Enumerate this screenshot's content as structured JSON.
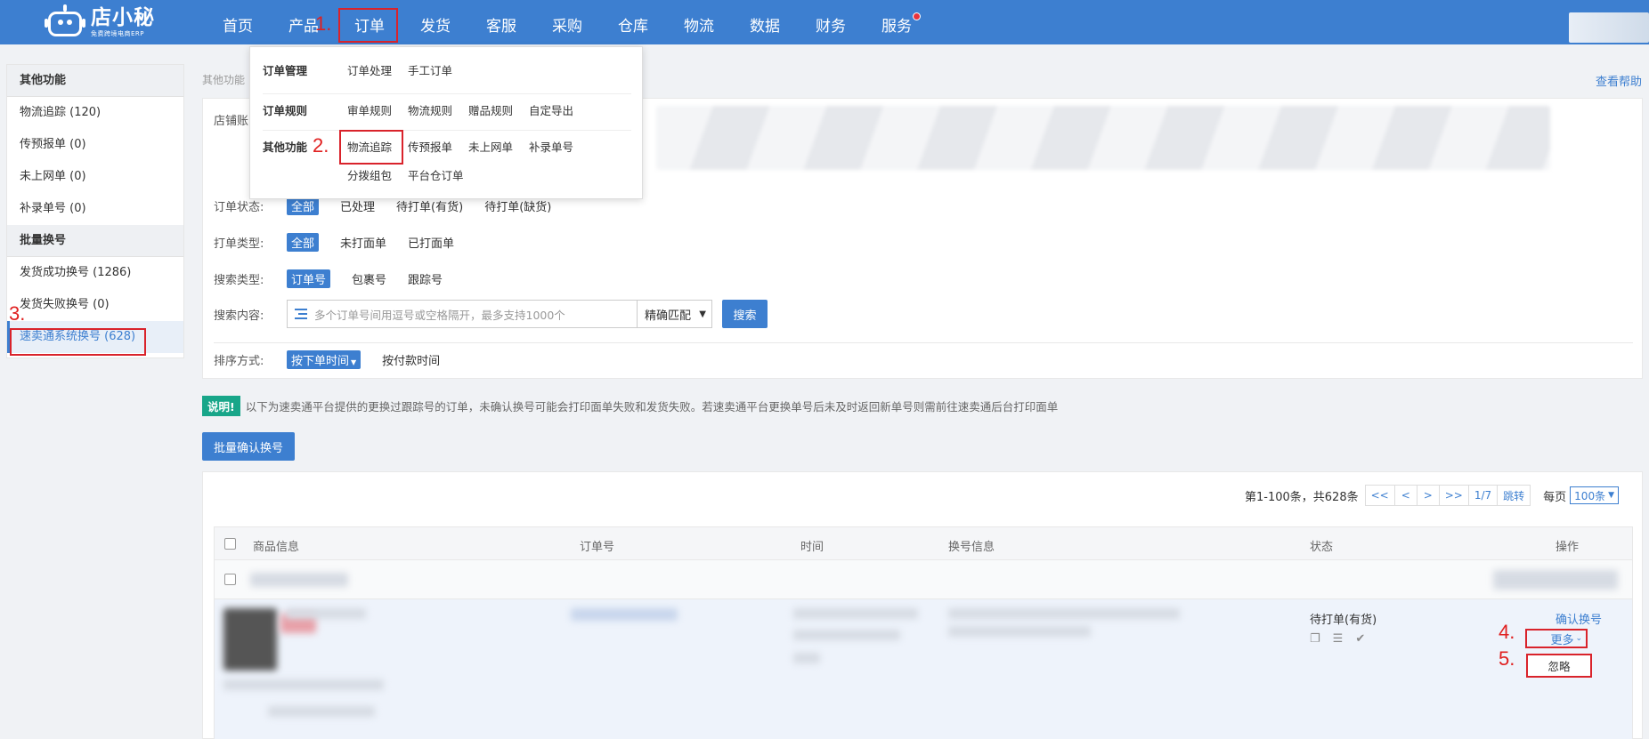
{
  "brand": {
    "name": "店小秘",
    "subtitle": "免费跨境电商ERP"
  },
  "nav": [
    {
      "label": "首页"
    },
    {
      "label": "产品"
    },
    {
      "label": "订单"
    },
    {
      "label": "发货"
    },
    {
      "label": "客服"
    },
    {
      "label": "采购"
    },
    {
      "label": "仓库"
    },
    {
      "label": "物流"
    },
    {
      "label": "数据"
    },
    {
      "label": "财务"
    },
    {
      "label": "服务"
    }
  ],
  "annotations": [
    "1.",
    "2.",
    "3.",
    "4.",
    "5."
  ],
  "dropdown": {
    "groups": [
      {
        "title": "订单管理",
        "links": [
          "订单处理",
          "手工订单"
        ]
      },
      {
        "title": "订单规则",
        "links": [
          "审单规则",
          "物流规则",
          "赠品规则",
          "自定导出"
        ]
      },
      {
        "title": "其他功能",
        "links": [
          "物流追踪",
          "传预报单",
          "未上网单",
          "补录单号"
        ],
        "extra": [
          "分拨组包",
          "平台仓订单"
        ]
      }
    ]
  },
  "sidebar": {
    "group1": "其他功能",
    "items1": [
      "物流追踪 (120)",
      "传预报单 (0)",
      "未上网单 (0)",
      "补录单号 (0)"
    ],
    "group2": "批量换号",
    "items2": [
      "发货成功换号 (1286)",
      "发货失败换号 (0)",
      "速卖通系统换号 (628)"
    ]
  },
  "breadcrumb": "其他功能",
  "help": "查看帮助",
  "filters": {
    "shop_label": "店铺账",
    "status_label": "订单状态:",
    "status_options": [
      "全部",
      "已处理",
      "待打单(有货)",
      "待打单(缺货)"
    ],
    "print_label": "打单类型:",
    "print_options": [
      "全部",
      "未打面单",
      "已打面单"
    ],
    "search_type_label": "搜索类型:",
    "search_type_options": [
      "订单号",
      "包裹号",
      "跟踪号"
    ],
    "search_label": "搜索内容:",
    "search_placeholder": "多个订单号间用逗号或空格隔开，最多支持1000个",
    "match_mode": "精确匹配",
    "search_button": "搜索",
    "sort_label": "排序方式:",
    "sort_options": [
      "按下单时间",
      "按付款时间"
    ]
  },
  "notice": {
    "tag": "说明!",
    "text": "以下为速卖通平台提供的更换过跟踪号的订单，未确认换号可能会打印面单失败和发货失败。若速卖通平台更换单号后未及时返回新单号则需前往速卖通后台打印面单"
  },
  "batch_button": "批量确认换号",
  "pager": {
    "info": "第1-100条，共628条",
    "buttons": [
      "<<",
      "<",
      ">",
      ">>",
      "1/7",
      "跳转"
    ],
    "per_label": "每页",
    "per_value": "100条"
  },
  "table": {
    "headers": [
      "商品信息",
      "订单号",
      "时间",
      "换号信息",
      "状态",
      "操作"
    ]
  },
  "row": {
    "status": "待打单(有货)",
    "confirm": "确认换号",
    "more": "更多",
    "ignore": "忽略"
  },
  "colors": {
    "primary": "#3d7fd0",
    "highlight": "#d9232b",
    "notice_tag": "#18a689"
  }
}
